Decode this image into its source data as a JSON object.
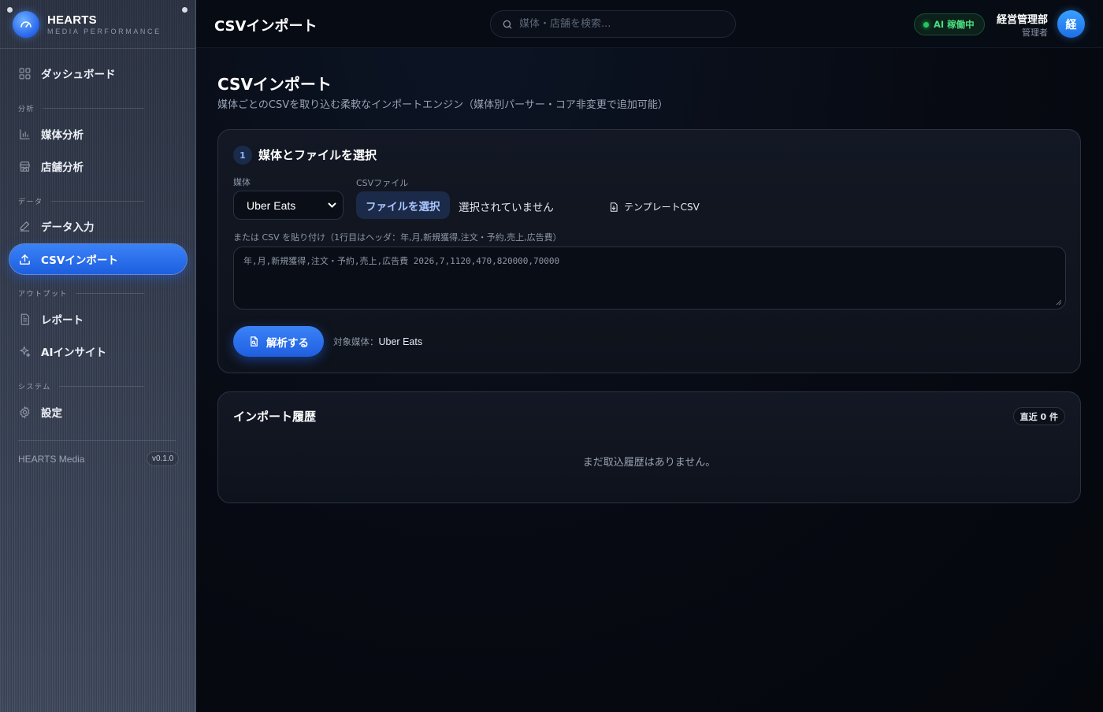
{
  "brand": {
    "title": "HEARTS",
    "subtitle": "MEDIA PERFORMANCE"
  },
  "sidebar": {
    "items": [
      {
        "label": "ダッシュボード",
        "icon": "grid-icon"
      },
      {
        "section": "分析"
      },
      {
        "label": "媒体分析",
        "icon": "bar-chart-icon"
      },
      {
        "label": "店舗分析",
        "icon": "store-icon"
      },
      {
        "section": "データ"
      },
      {
        "label": "データ入力",
        "icon": "pencil-icon"
      },
      {
        "label": "CSVインポート",
        "icon": "upload-icon",
        "active": true
      },
      {
        "section": "アウトプット"
      },
      {
        "label": "レポート",
        "icon": "document-icon"
      },
      {
        "label": "AIインサイト",
        "icon": "sparkle-icon"
      },
      {
        "section": "システム"
      },
      {
        "label": "設定",
        "icon": "gear-icon"
      }
    ],
    "footer_name": "HEARTS Media",
    "version": "v0.1.0"
  },
  "topbar": {
    "title": "CSVインポート",
    "search_placeholder": "媒体・店舗を検索...",
    "ai_status": "AI 稼働中",
    "user_name": "経営管理部",
    "user_role": "管理者",
    "avatar_initial": "経"
  },
  "page": {
    "title": "CSVインポート",
    "description": "媒体ごとのCSVを取り込む柔軟なインポートエンジン（媒体別パーサー・コア非変更で追加可能）"
  },
  "step1": {
    "number": "1",
    "title": "媒体とファイルを選択",
    "media_label": "媒体",
    "media_value": "Uber Eats",
    "file_label": "CSVファイル",
    "file_button": "ファイルを選択",
    "file_status": "選択されていません",
    "template_link": "テンプレートCSV",
    "paste_label": "または CSV を貼り付け（1行目はヘッダ：年,月,新規獲得,注文・予約,売上,広告費）",
    "paste_placeholder": "年,月,新規獲得,注文・予約,売上,広告費 2026,7,1120,470,820000,70000",
    "parse_button": "解析する",
    "target_label": "対象媒体：",
    "target_value": "Uber Eats"
  },
  "history": {
    "title": "インポート履歴",
    "badge": "直近 0 件",
    "empty": "まだ取込履歴はありません。"
  },
  "colors": {
    "accent": "#3b82f6",
    "ai_green": "#22c55e"
  }
}
